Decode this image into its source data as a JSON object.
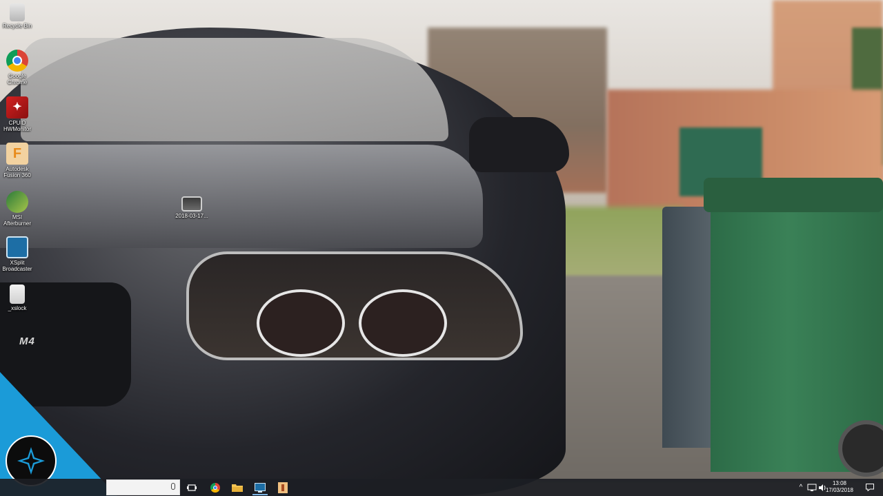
{
  "desktop": {
    "icons": [
      {
        "label": "Recycle Bin",
        "icon": "recycle-bin-icon"
      },
      {
        "label": "Google\nChrome",
        "icon": "chrome-icon"
      },
      {
        "label": "CPUID\nHWMonitor",
        "icon": "hwmonitor-icon"
      },
      {
        "label": "Autodesk\nFusion 360",
        "icon": "fusion360-icon"
      },
      {
        "label": "MSI\nAfterburner",
        "icon": "afterburner-icon"
      },
      {
        "label": "XSplit\nBroadcaster",
        "icon": "xsplit-icon"
      },
      {
        "label": "_xslock",
        "icon": "file-icon"
      },
      {
        "label": "2018-03-17...",
        "icon": "video-file-icon"
      }
    ],
    "wallpaper_badge": "M4"
  },
  "taskbar": {
    "search_placeholder": "",
    "pinned": [
      {
        "name": "task-view",
        "icon": "task-view-icon"
      },
      {
        "name": "chrome",
        "icon": "chrome-icon"
      },
      {
        "name": "file-explorer",
        "icon": "folder-icon"
      },
      {
        "name": "xsplit",
        "icon": "xsplit-icon"
      },
      {
        "name": "app",
        "icon": "app-icon"
      }
    ],
    "tray": {
      "chevron": "^",
      "clock_time": "13:08",
      "clock_date": "17/03/2018"
    }
  },
  "colors": {
    "taskbar": "#1c1e24",
    "corner_badge": "#1b9bd8"
  }
}
